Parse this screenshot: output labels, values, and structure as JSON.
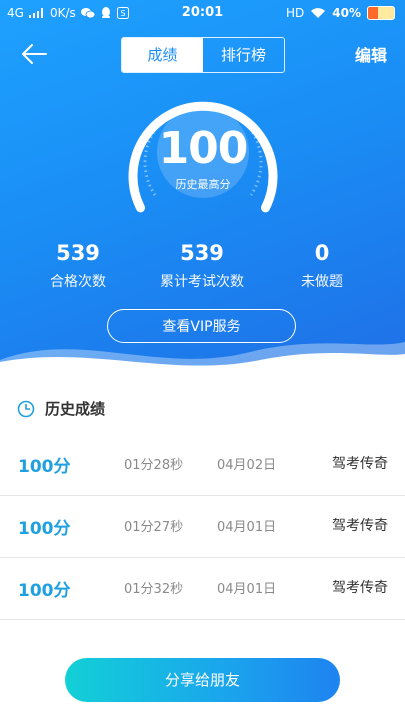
{
  "status_bar": {
    "network": "4G",
    "speed": "0K/s",
    "time": "20:01",
    "hd": "HD",
    "battery": "40%"
  },
  "nav": {
    "tabs": [
      "成绩",
      "排行榜"
    ],
    "active_tab": "成绩",
    "edit_label": "编辑"
  },
  "score": {
    "value": "100",
    "label": "历史最高分"
  },
  "stats": [
    {
      "value": "539",
      "label": "合格次数"
    },
    {
      "value": "539",
      "label": "累计考试次数"
    },
    {
      "value": "0",
      "label": "未做题"
    }
  ],
  "vip_button": "查看VIP服务",
  "history": {
    "title": "历史成绩",
    "rows": [
      {
        "score": "100分",
        "duration": "01分28秒",
        "date": "04月02日",
        "user": "驾考传奇"
      },
      {
        "score": "100分",
        "duration": "01分27秒",
        "date": "04月01日",
        "user": "驾考传奇"
      },
      {
        "score": "100分",
        "duration": "01分32秒",
        "date": "04月01日",
        "user": "驾考传奇"
      }
    ]
  },
  "share_button": "分享给朋友",
  "colors": {
    "header_blue": "#1a8ef5",
    "accent_score": "#1fa0e0",
    "share_start": "#12d0d6",
    "share_end": "#1e83f0"
  },
  "icons": {
    "back": "back-arrow-icon",
    "clock": "clock-icon",
    "wifi": "wifi-icon",
    "signal": "signal-icon"
  }
}
